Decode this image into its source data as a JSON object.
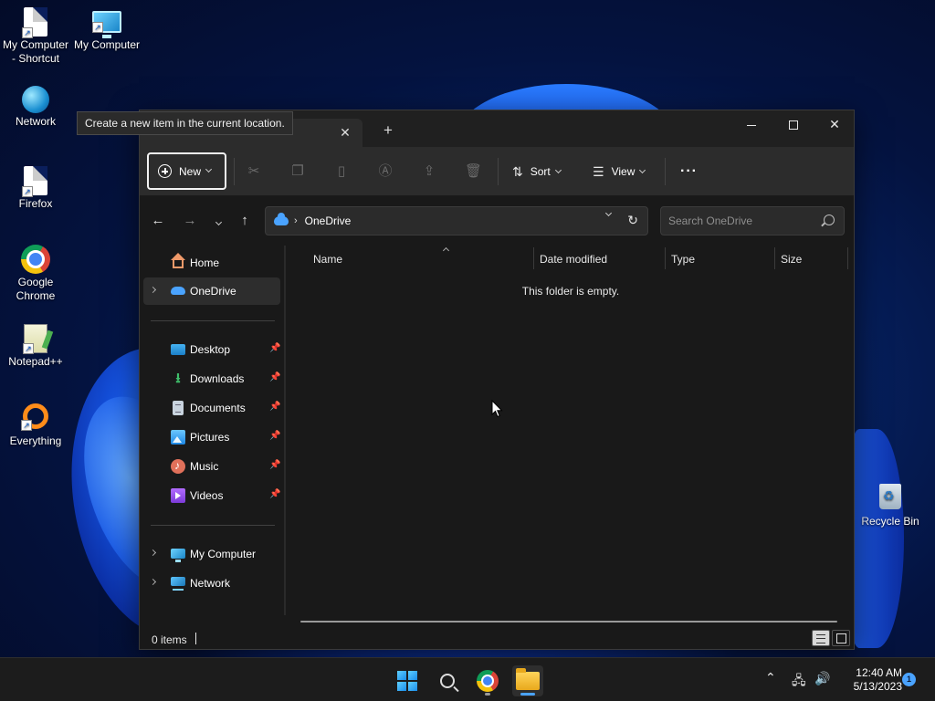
{
  "desktop": {
    "icons": [
      {
        "label": "My Computer - Shortcut"
      },
      {
        "label": "My Computer"
      },
      {
        "label": "Network"
      },
      {
        "label": "Firefox"
      },
      {
        "label": "Google Chrome"
      },
      {
        "label": "Notepad++"
      },
      {
        "label": "Everything"
      },
      {
        "label": "Recycle Bin"
      }
    ]
  },
  "tooltip": {
    "text": "Create a new item in the current location."
  },
  "window": {
    "titlebar": {
      "new_tab": "+",
      "close_tab": "✕"
    },
    "toolbar": {
      "new_label": "New",
      "sort_label": "Sort",
      "view_label": "View",
      "more_label": "···",
      "disabled_icons": [
        "cut-icon",
        "copy-icon",
        "paste-icon",
        "rename-icon",
        "share-icon",
        "delete-icon"
      ]
    },
    "address": {
      "path": "OneDrive",
      "separator": "›"
    },
    "search": {
      "placeholder": "Search OneDrive"
    },
    "sidebar": {
      "items": [
        {
          "label": "Home",
          "icon": "home-icon"
        },
        {
          "label": "OneDrive",
          "icon": "onedrive-icon",
          "selected": true
        },
        {
          "label": "Desktop",
          "icon": "desktop-folder-icon",
          "pinned": true
        },
        {
          "label": "Downloads",
          "icon": "downloads-icon",
          "pinned": true
        },
        {
          "label": "Documents",
          "icon": "documents-icon",
          "pinned": true
        },
        {
          "label": "Pictures",
          "icon": "pictures-icon",
          "pinned": true
        },
        {
          "label": "Music",
          "icon": "music-icon",
          "pinned": true
        },
        {
          "label": "Videos",
          "icon": "videos-icon",
          "pinned": true
        },
        {
          "label": "My Computer",
          "icon": "computer-icon"
        },
        {
          "label": "Network",
          "icon": "network-icon"
        }
      ]
    },
    "columns": [
      "Name",
      "Date modified",
      "Type",
      "Size"
    ],
    "empty_message": "This folder is empty.",
    "status": {
      "item_count": "0 items"
    }
  },
  "taskbar": {
    "apps": [
      "start-icon",
      "search-icon",
      "chrome-icon",
      "file-explorer-icon"
    ],
    "clock": {
      "time": "12:40 AM",
      "date": "5/13/2023"
    },
    "notification_count": "1"
  },
  "colors": {
    "accent": "#4aa3ff",
    "window_bg": "#191919",
    "toolbar_bg": "#2c2c2c"
  }
}
